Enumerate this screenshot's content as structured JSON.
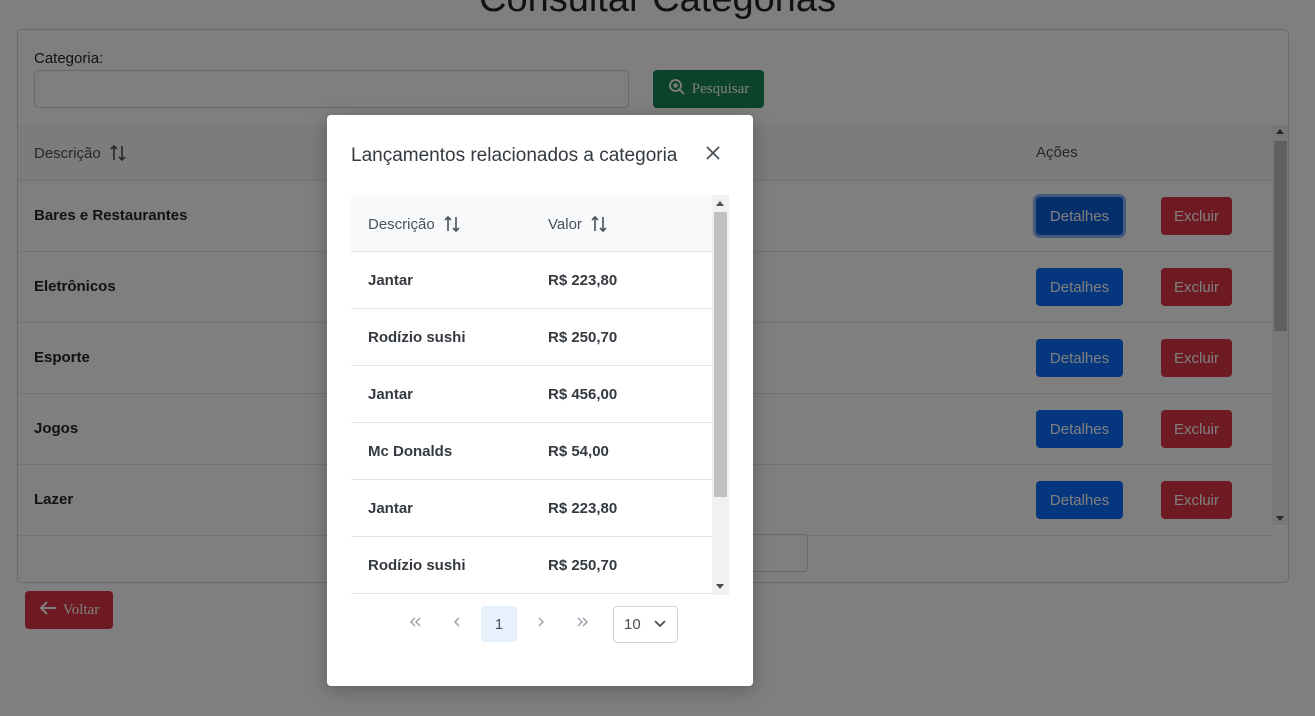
{
  "page": {
    "title": "Consultar Categorias",
    "filter_label": "Categoria:",
    "filter_value": "",
    "search_button": "Pesquisar",
    "back_button": "Voltar"
  },
  "table": {
    "columns": [
      "Descrição",
      "Ações"
    ],
    "rows": [
      {
        "descricao": "Bares e Restaurantes",
        "detalhes": "Detalhes",
        "excluir": "Excluir"
      },
      {
        "descricao": "Eletrônicos",
        "detalhes": "Detalhes",
        "excluir": "Excluir"
      },
      {
        "descricao": "Esporte",
        "detalhes": "Detalhes",
        "excluir": "Excluir"
      },
      {
        "descricao": "Jogos",
        "detalhes": "Detalhes",
        "excluir": "Excluir"
      },
      {
        "descricao": "Lazer",
        "detalhes": "Detalhes",
        "excluir": "Excluir"
      }
    ]
  },
  "modal": {
    "title": "Lançamentos relacionados a categoria",
    "columns": [
      "Descrição",
      "Valor"
    ],
    "rows": [
      {
        "descricao": "Jantar",
        "valor": "R$ 223,80"
      },
      {
        "descricao": "Rodízio sushi",
        "valor": "R$ 250,70"
      },
      {
        "descricao": "Jantar",
        "valor": "R$ 456,00"
      },
      {
        "descricao": "Mc Donalds",
        "valor": "R$ 54,00"
      },
      {
        "descricao": "Jantar",
        "valor": "R$ 223,80"
      },
      {
        "descricao": "Rodízio sushi",
        "valor": "R$ 250,70"
      }
    ],
    "pagination": {
      "current_page": "1",
      "rows_per_page": "10"
    }
  },
  "colors": {
    "primary": "#0d6efd",
    "danger": "#dc3545",
    "success": "#198754",
    "backdrop": "rgba(0,0,0,0.5)"
  },
  "icons": {
    "search": "zoom-in-icon",
    "back": "arrow-left-icon",
    "sort": "sort-icon",
    "close": "close-icon"
  }
}
